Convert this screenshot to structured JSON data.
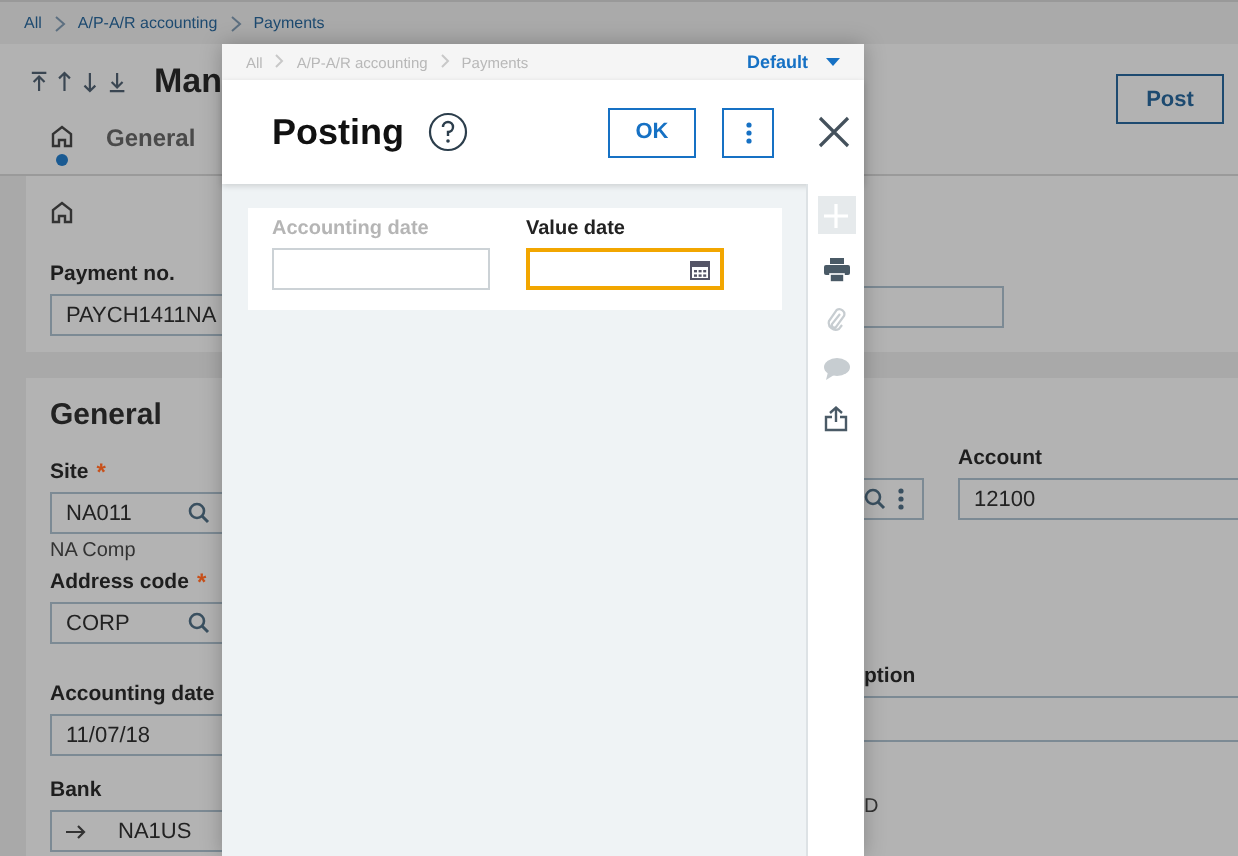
{
  "breadcrumb": [
    "All",
    "A/P-A/R accounting",
    "Payments"
  ],
  "page": {
    "title": "Man",
    "tabs": [
      {
        "kind": "home",
        "selected": true
      },
      {
        "kind": "text",
        "label": "General",
        "selected": false
      }
    ],
    "post_button": "Post",
    "header_card": {
      "label": "Payment no.",
      "value": "PAYCH1411NA"
    },
    "general": {
      "title": "General",
      "fields": [
        {
          "label": "Site",
          "required_mark": "*",
          "value": "NA011",
          "kind": "lookup",
          "note": "NA Comp"
        },
        {
          "label": "Address code",
          "required_mark": "*",
          "value": "CORP",
          "kind": "lookup"
        },
        {
          "label": "Accounting date",
          "value": "11/07/18",
          "kind": "text"
        },
        {
          "label": "Bank",
          "value": "NA1US",
          "kind": "link"
        }
      ],
      "account": {
        "label": "Account",
        "value": "12100"
      },
      "description_label": "ption",
      "cut_text": "D"
    }
  },
  "dialog": {
    "breadcrumb": [
      "All",
      "A/P-A/R accounting",
      "Payments"
    ],
    "view": "Default",
    "title": "Posting",
    "ok_button": "OK",
    "fields": [
      {
        "label": "Accounting date",
        "kind": "text",
        "disabled": true,
        "focused": false
      },
      {
        "label": "Value date",
        "kind": "date",
        "disabled": false,
        "focused": true
      }
    ],
    "tools": [
      {
        "kind": "add",
        "disabled": true
      },
      {
        "kind": "print",
        "disabled": false
      },
      {
        "kind": "attach",
        "disabled": true
      },
      {
        "kind": "comment",
        "disabled": true
      },
      {
        "kind": "share",
        "disabled": false
      }
    ]
  }
}
